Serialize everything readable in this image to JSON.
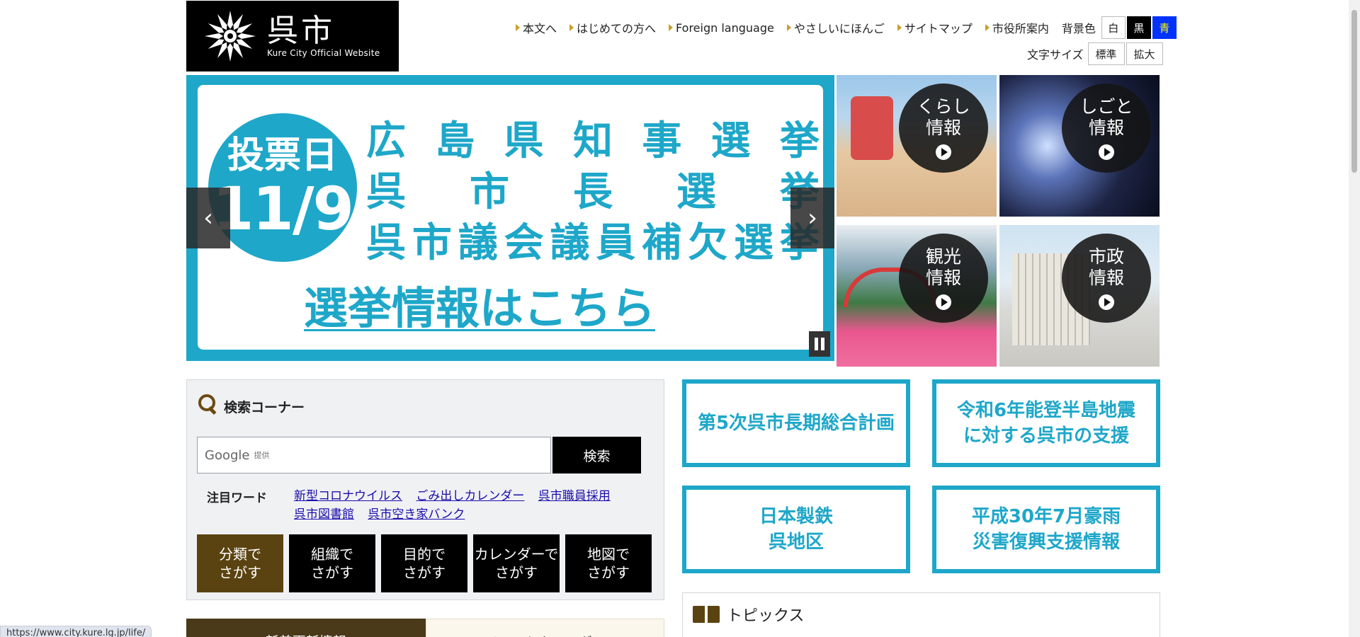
{
  "logo": {
    "name_jp": "呉市",
    "name_en": "Kure City Official Website"
  },
  "util_nav": [
    {
      "label": "本文へ"
    },
    {
      "label": "はじめての方へ"
    },
    {
      "label": "Foreign language"
    },
    {
      "label": "やさしいにほんご"
    },
    {
      "label": "サイトマップ"
    },
    {
      "label": "市役所案内"
    }
  ],
  "bg_color": {
    "label": "背景色",
    "white": "白",
    "black": "黒",
    "blue": "青"
  },
  "text_size": {
    "label": "文字サイズ",
    "standard": "標準",
    "large": "拡大"
  },
  "slider": {
    "vote_title": "投票日",
    "vote_date": "11/9",
    "line1": "広島県知事選挙",
    "line2": "呉市長選挙",
    "line3": "呉市議会議員補欠選挙",
    "info": "選挙情報はこちら",
    "prev": "‹",
    "next": "›"
  },
  "tiles": [
    {
      "label": "くらし\n情報"
    },
    {
      "label": "しごと\n情報"
    },
    {
      "label": "観光\n情報"
    },
    {
      "label": "市政\n情報"
    }
  ],
  "search": {
    "title": "検索コーナー",
    "google": "Google",
    "provided": "提供",
    "button": "検索",
    "keyword_label": "注目ワード",
    "keywords": [
      "新型コロナウイルス",
      "ごみ出しカレンダー",
      "呉市職員採用",
      "呉市図書館",
      "呉市空き家バンク"
    ],
    "finders": [
      "分類で\nさがす",
      "組織で\nさがす",
      "目的で\nさがす",
      "カレンダーで\nさがす",
      "地図で\nさがす"
    ]
  },
  "banners": [
    {
      "label": "第5次呉市長期総合計画"
    },
    {
      "label": "令和6年能登半島地震\nに対する呉市の支援"
    },
    {
      "label": "日本製鉄\n呉地区"
    },
    {
      "label": "平成30年7月豪雨\n災害復興支援情報"
    }
  ],
  "topics": {
    "title": "トピックス"
  },
  "news_tabs": [
    "新着更新情報",
    "イベントカレンダー"
  ],
  "status_url": "https://www.city.kure.lg.jp/life/"
}
